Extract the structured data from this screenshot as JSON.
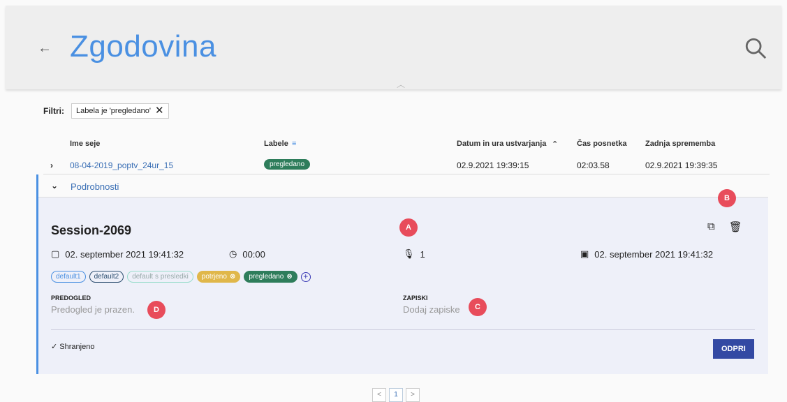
{
  "header": {
    "title": "Zgodovina",
    "back_icon": "arrow-left-icon",
    "search_icon": "search-icon",
    "collapse_icon": "chevron-up-icon"
  },
  "filters": {
    "label": "Filtri:",
    "chip": "Labela je 'pregledano'"
  },
  "table": {
    "headers": [
      "Ime seje",
      "Labele",
      "Datum in ura ustvarjanja",
      "Čas posnetka",
      "Zadnja sprememba"
    ],
    "row": {
      "name": "08-04-2019_poptv_24ur_15",
      "label": "pregledano",
      "created": "02.9.2021 19:39:15",
      "duration": "02:03.58",
      "modified": "02.9.2021 19:39:35"
    }
  },
  "details": {
    "title": "Podrobnosti",
    "session": "Session-2069",
    "date": "02. september 2021 19:41:32",
    "time": "00:00",
    "speakers": "1",
    "date_right": "02. september 2021 19:41:32",
    "labels": [
      "default1",
      "default2",
      "default s presledki",
      "potrjeno",
      "pregledano"
    ],
    "preview_h": "PREDOGLED",
    "preview_v": "Predogled je prazen.",
    "notes_h": "ZAPISKI",
    "notes_v": "Dodaj zapiske",
    "saved": "Shranjeno",
    "open": "ODPRI"
  },
  "markers": [
    "A",
    "B",
    "C",
    "D"
  ],
  "pager": [
    "<",
    "1",
    ">"
  ]
}
